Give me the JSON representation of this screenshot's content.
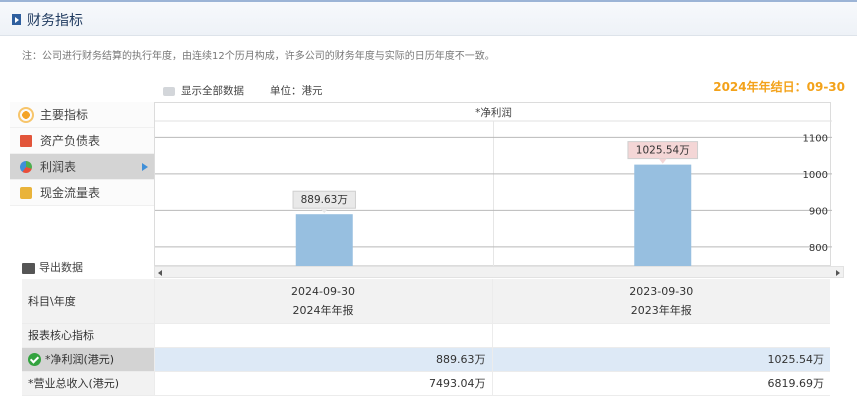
{
  "header": {
    "title": "财务指标"
  },
  "note": "注：公司进行财务结算的执行年度，由连续12个历月构成，许多公司的财务年度与实际的日历年度不一致。",
  "toolbar": {
    "show_all_label": "显示全部数据",
    "unit_label": "单位：港元"
  },
  "year_end": "2024年年结日：09-30",
  "side_nav": {
    "items": [
      {
        "label": "主要指标",
        "icon": "sun-icon"
      },
      {
        "label": "资产负债表",
        "icon": "document-icon"
      },
      {
        "label": "利润表",
        "icon": "pie-chart-icon",
        "active": true
      },
      {
        "label": "现金流量表",
        "icon": "coins-icon"
      }
    ]
  },
  "export_label": "导出数据",
  "chart_data": {
    "type": "bar",
    "title": "*净利润",
    "categories": [
      "2024-09-30",
      "2023-09-30"
    ],
    "values": [
      889.63,
      1025.54
    ],
    "value_labels": [
      "889.63万",
      "1025.54万"
    ],
    "y_ticks": [
      800,
      900,
      1000,
      1100
    ],
    "ylim": [
      745,
      1145
    ],
    "ylabel": "",
    "xlabel": "",
    "grid": true,
    "bar_color": "#97bfe0",
    "label_colors": [
      "#e9e9e9",
      "#f4d6d6"
    ]
  },
  "table": {
    "header_label": "科目\\年度",
    "columns": [
      {
        "date": "2024-09-30",
        "report": "2024年年报"
      },
      {
        "date": "2023-09-30",
        "report": "2023年年报"
      }
    ],
    "section_label": "报表核心指标",
    "rows": [
      {
        "label": "*净利润(港元)",
        "values": [
          "889.63万",
          "1025.54万"
        ],
        "highlight": true
      },
      {
        "label": "*营业总收入(港元)",
        "values": [
          "7493.04万",
          "6819.69万"
        ]
      }
    ]
  },
  "colors": {
    "accent": "#2f5f9e",
    "year_end": "#f3a21a",
    "highlight_row": "#dde9f6"
  }
}
